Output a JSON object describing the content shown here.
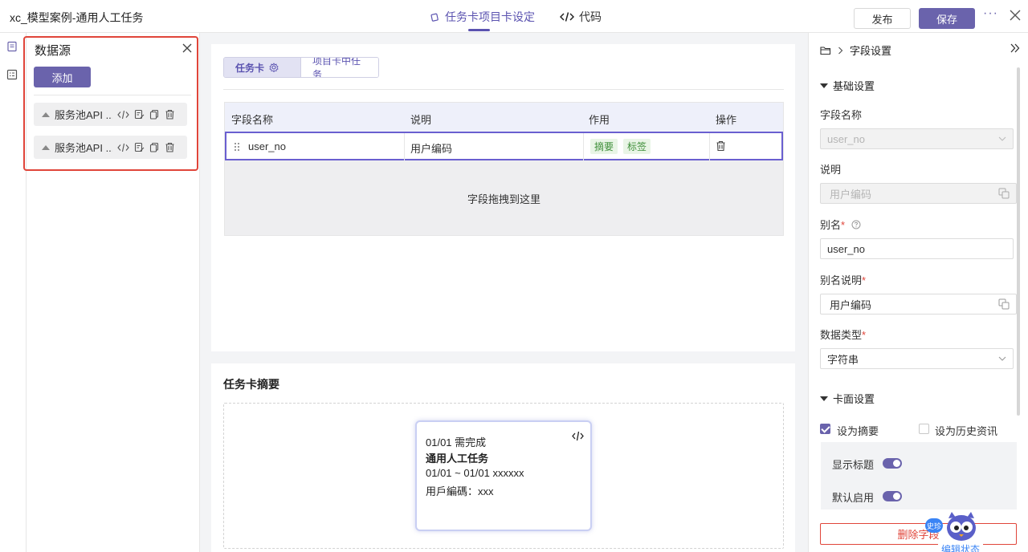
{
  "header": {
    "title": "xc_模型案例-通用人工任务",
    "tabs": [
      {
        "label": "任务卡项目卡设定",
        "active": true
      },
      {
        "label": "代码",
        "active": false
      }
    ],
    "publish_label": "发布",
    "save_label": "保存",
    "more_label": "···"
  },
  "datasource": {
    "title": "数据源",
    "add_label": "添加",
    "items": [
      {
        "label": "服务池API ..."
      },
      {
        "label": "服务池API ..."
      }
    ]
  },
  "main": {
    "segments": [
      {
        "label": "任务卡",
        "active": true
      },
      {
        "label": "项目卡中任务",
        "active": false
      }
    ],
    "table": {
      "headers": [
        "字段名称",
        "说明",
        "作用",
        "操作"
      ],
      "rows": [
        {
          "field": "user_no",
          "desc": "用户编码",
          "tags": [
            "摘要",
            "标签"
          ]
        }
      ],
      "drop_hint": "字段拖拽到这里"
    }
  },
  "summary": {
    "title": "任务卡摘要",
    "preview": {
      "line1": "01/01 需完成",
      "line2": "通用人工任务",
      "line3": "01/01 ~ 01/01 xxxxxx",
      "line4": "用戶編碼：xxx"
    }
  },
  "field_settings": {
    "breadcrumb": "字段设置",
    "basic_section": "基础设置",
    "field_name_label": "字段名称",
    "field_name_value": "user_no",
    "desc_label": "说明",
    "desc_value": "用户编码",
    "alias_label": "别名",
    "alias_value": "user_no",
    "alias_desc_label": "别名说明",
    "alias_desc_value": "用户编码",
    "data_type_label": "数据类型",
    "data_type_value": "字符串",
    "card_section": "卡面设置",
    "set_summary_label": "设为摘要",
    "set_summary_checked": true,
    "set_history_label": "设为历史资讯",
    "set_history_checked": false,
    "show_title_label": "显示标题",
    "show_title_on": true,
    "default_enable_label": "默认启用",
    "default_enable_on": true,
    "delete_label": "删除字段"
  },
  "assistant": {
    "badge": "史珍",
    "tip": "编辑状态"
  },
  "colors": {
    "accent": "#6a63ac",
    "danger": "#e0453a",
    "tag_bg": "#e9f5e6",
    "tag_fg": "#3f8f3a"
  }
}
